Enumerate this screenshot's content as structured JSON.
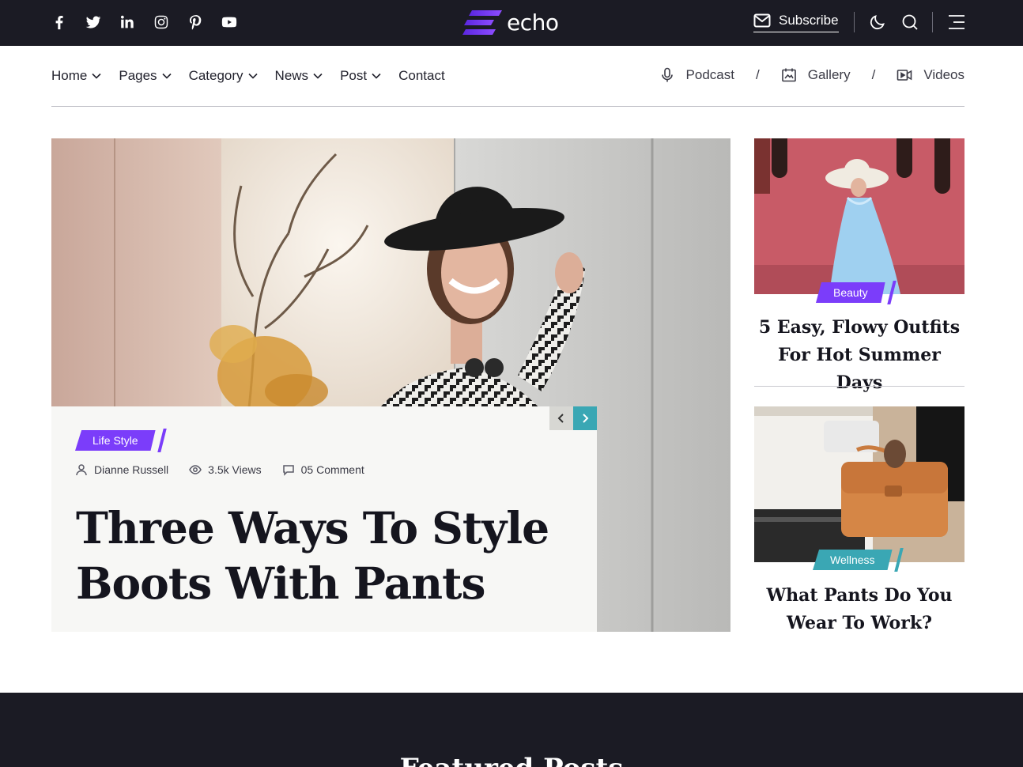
{
  "topbar": {
    "social_icons": [
      "facebook-icon",
      "twitter-icon",
      "linkedin-icon",
      "instagram-icon",
      "pinterest-icon",
      "youtube-icon"
    ],
    "logo_text": "echo",
    "subscribe_label": "Subscribe",
    "icons": [
      "mail-icon",
      "moon-icon",
      "search-icon",
      "menu-icon"
    ]
  },
  "nav": {
    "items": [
      {
        "label": "Home",
        "dropdown": true
      },
      {
        "label": "Pages",
        "dropdown": true
      },
      {
        "label": "Category",
        "dropdown": true
      },
      {
        "label": "News",
        "dropdown": true
      },
      {
        "label": "Post",
        "dropdown": true
      },
      {
        "label": "Contact",
        "dropdown": false
      }
    ],
    "quick_links": [
      {
        "label": "Podcast",
        "icon": "microphone-icon"
      },
      {
        "label": "Gallery",
        "icon": "gallery-icon"
      },
      {
        "label": "Videos",
        "icon": "video-icon"
      }
    ],
    "separator": "/"
  },
  "hero": {
    "category": "Life Style",
    "author": "Dianne Russell",
    "views": "3.5k Views",
    "comments": "05 Comment",
    "title": "Three Ways To Style Boots With Pants"
  },
  "side_posts": [
    {
      "category": "Beauty",
      "title": "5 Easy, Flowy Outfits For Hot Summer Days"
    },
    {
      "category": "Wellness",
      "title": "What Pants Do You Wear To Work?"
    }
  ],
  "band": {
    "title": "Featured Posts"
  },
  "colors": {
    "dark": "#1b1b24",
    "accent_purple": "#7b3dfa",
    "accent_teal": "#3aa7b4"
  }
}
